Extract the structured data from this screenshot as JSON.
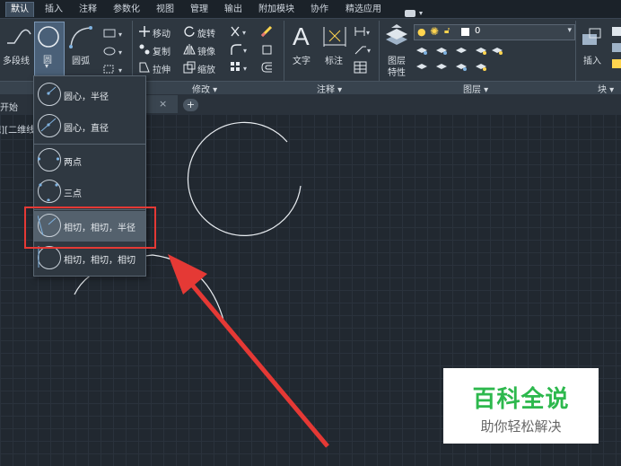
{
  "ribbon_tabs": [
    "默认",
    "插入",
    "注释",
    "参数化",
    "视图",
    "管理",
    "输出",
    "附加模块",
    "协作",
    "精选应用"
  ],
  "ribbon": {
    "polyline_label": "多段线",
    "circle_label": "圆",
    "arc_label": "圆弧",
    "move_label": "移动",
    "rotate_label": "旋转",
    "copy_label": "复制",
    "mirror_label": "镜像",
    "stretch_label": "拉伸",
    "scale_label": "缩放",
    "text_label": "文字",
    "dimension_label": "标注",
    "layer_prop_label1": "图层",
    "layer_prop_label2": "特性",
    "insert_label": "插入",
    "layer_value": "0",
    "modify_panel": "修改 ▾",
    "annotation_panel": "注释 ▾",
    "layers_panel": "图层 ▾",
    "block_panel": "块 ▾"
  },
  "document": {
    "start_tab": "开始",
    "close_glyph": "×",
    "new_tab_glyph": "+",
    "view_label": "[-][俯视][二维线框]"
  },
  "circle_menu": {
    "items": [
      {
        "label": "圆心，半径",
        "icon": "circle-center-radius-icon"
      },
      {
        "label": "圆心，直径",
        "icon": "circle-center-diameter-icon"
      },
      {
        "label": "两点",
        "icon": "circle-2point-icon"
      },
      {
        "label": "三点",
        "icon": "circle-3point-icon"
      },
      {
        "label": "相切，相切，半径",
        "icon": "circle-ttr-icon"
      },
      {
        "label": "相切，相切，相切",
        "icon": "circle-ttt-icon"
      }
    ],
    "highlighted_index": 4
  },
  "watermark": {
    "title": "百科全说",
    "subtitle": "助你轻松解决"
  },
  "colors": {
    "annotation_red": "#e53935",
    "watermark_green": "#2db84d",
    "canvas_bg": "#212830"
  }
}
